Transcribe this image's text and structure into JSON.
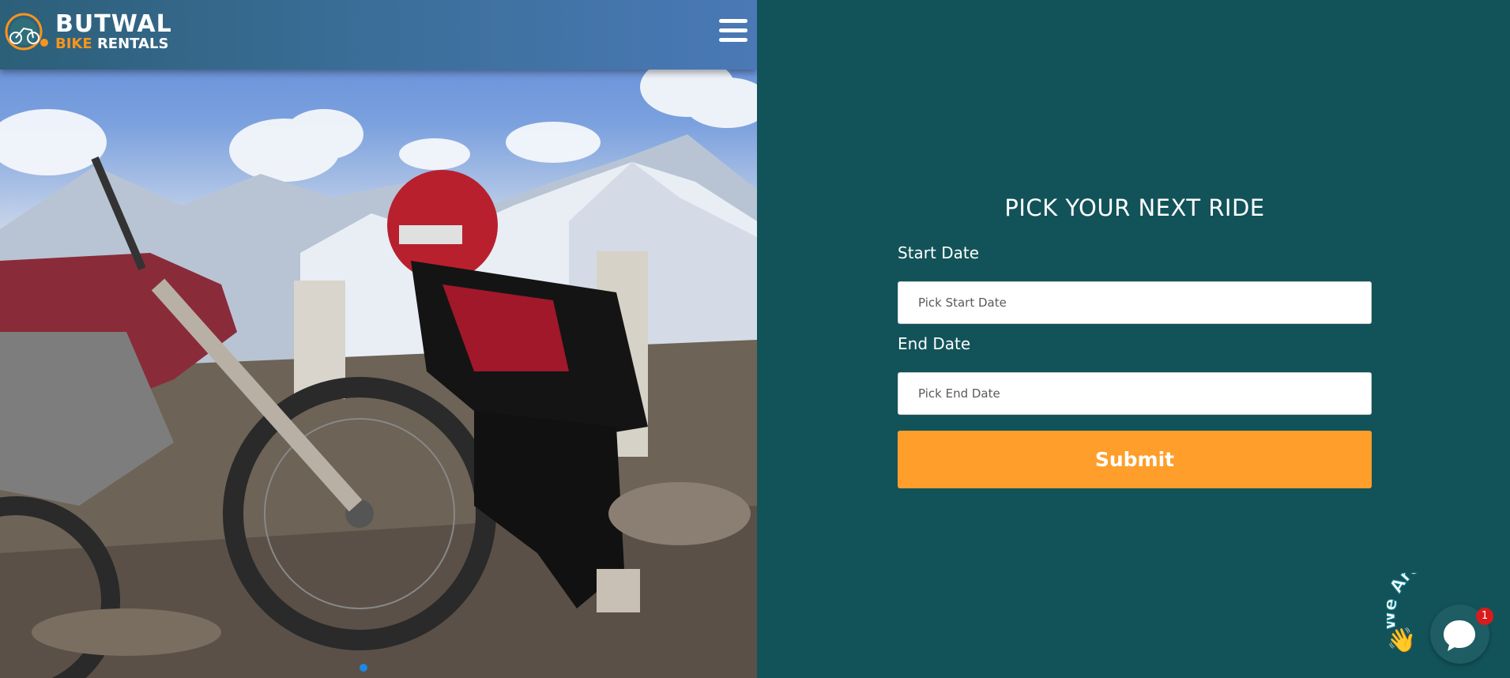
{
  "header": {
    "logo_line1": "BUTWAL",
    "logo_line2_accent": "BIKE",
    "logo_line2_rest": " RENTALS",
    "menu_icon": "hamburger-menu-icon"
  },
  "hero": {
    "image_description": "",
    "slider_active_index": 0,
    "slider_count": 1
  },
  "form": {
    "title": "PICK YOUR NEXT RIDE",
    "start_label": "Start Date",
    "start_placeholder": "Pick Start Date",
    "end_label": "End Date",
    "end_placeholder": "Pick End Date",
    "submit_label": "Submit"
  },
  "chat": {
    "tagline": "We Are Here!",
    "unread_count": "1",
    "icon": "chat-bubble-icon"
  },
  "colors": {
    "panel_bg": "#125359",
    "accent_orange": "#ff9e2b",
    "logo_orange": "#f7941d",
    "badge_red": "#d91b1b",
    "slider_dot": "#1e88e5"
  }
}
